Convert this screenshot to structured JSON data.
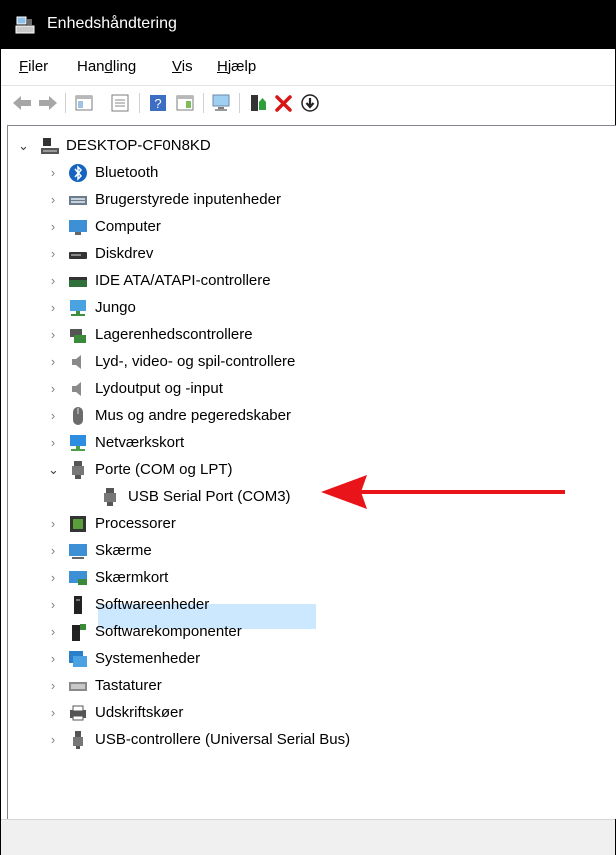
{
  "window": {
    "title": "Enhedshåndtering"
  },
  "menu": {
    "items": [
      {
        "label": "Filer",
        "key": "F",
        "rest": "iler"
      },
      {
        "label": "Handling",
        "key": "d",
        "pre": "Han",
        "rest": "ling"
      },
      {
        "label": "Vis",
        "key": "V",
        "rest": "is"
      },
      {
        "label": "Hjælp",
        "key": "H",
        "rest": "jælp"
      }
    ]
  },
  "toolbar": {
    "icons": [
      "back-icon",
      "forward-icon",
      "properties-pane-icon",
      "show-hide-icon",
      "help-icon",
      "action-pane-icon",
      "monitor-scan-icon",
      "update-driver-icon",
      "uninstall-icon",
      "disable-device-icon"
    ]
  },
  "tree": {
    "root": "DESKTOP-CF0N8KD",
    "categories": [
      "Bluetooth",
      "Brugerstyrede inputenheder",
      "Computer",
      "Diskdrev",
      "IDE ATA/ATAPI-controllere",
      "Jungo",
      "Lagerenhedscontrollere",
      "Lyd-, video- og spil-controllere",
      "Lydoutput og -input",
      "Mus og andre pegeredskaber",
      "Netværkskort",
      "Porte (COM og LPT)",
      "Processorer",
      "Skærme",
      "Skærmkort",
      "Softwareenheder",
      "Softwarekomponenter",
      "Systemenheder",
      "Tastaturer",
      "Udskriftskøer",
      "USB-controllere (Universal Serial Bus)"
    ],
    "expanded_child": "USB Serial Port (COM3)"
  },
  "colors": {
    "selection": "#cce8ff",
    "arrow": "#e8141a",
    "titlebar": "#000000"
  }
}
